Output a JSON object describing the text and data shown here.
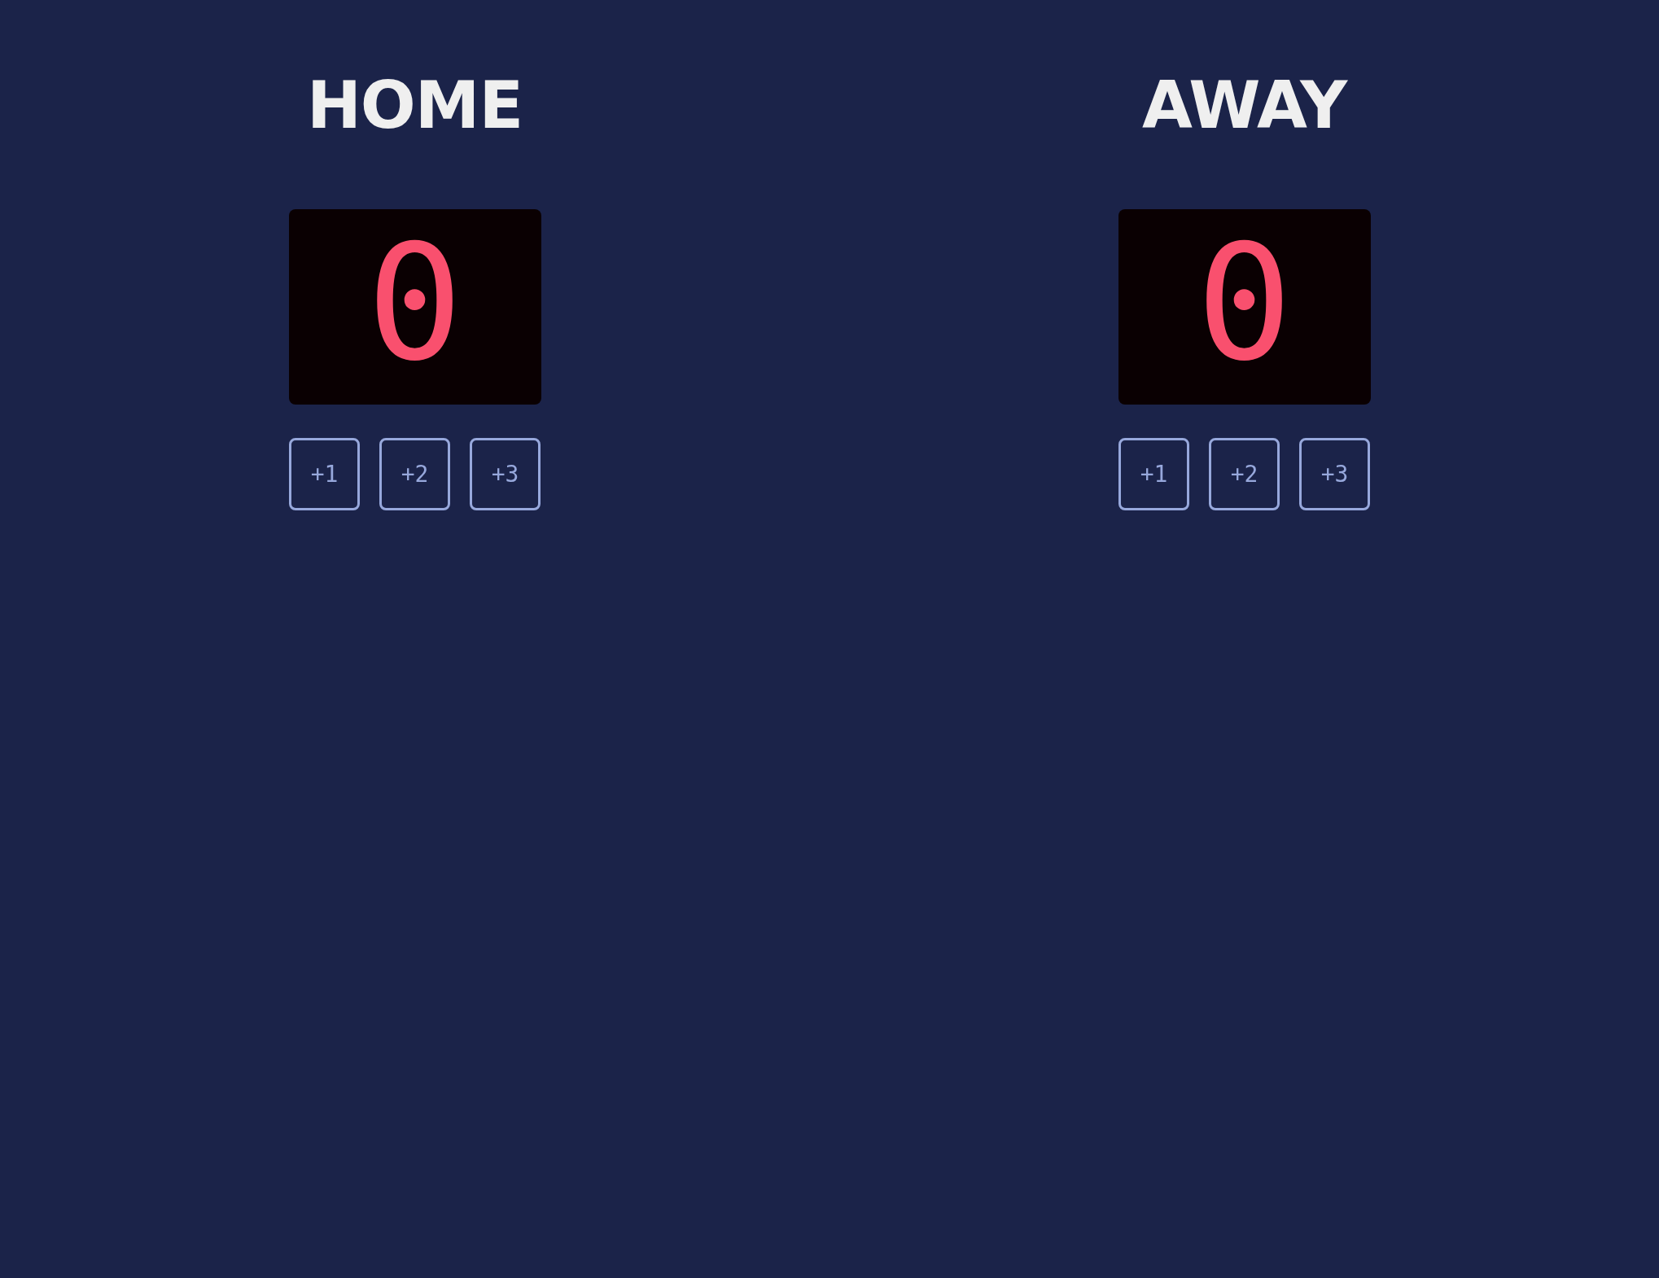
{
  "teams": [
    {
      "name": "HOME",
      "score": "0",
      "buttons": [
        "+1",
        "+2",
        "+3"
      ]
    },
    {
      "name": "AWAY",
      "score": "0",
      "buttons": [
        "+1",
        "+2",
        "+3"
      ]
    }
  ]
}
